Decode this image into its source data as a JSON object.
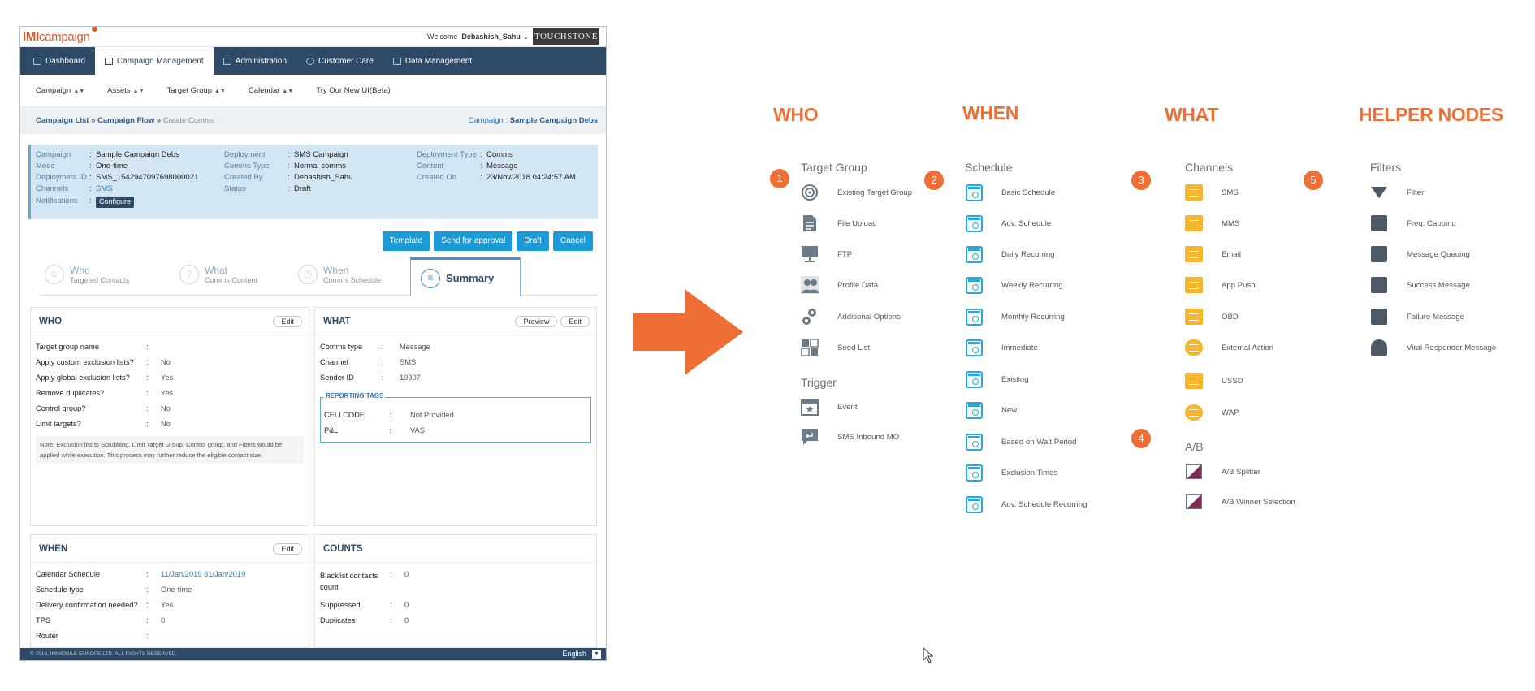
{
  "app": {
    "logo_imi": "IMI",
    "logo_rest": "campaign",
    "welcome_label": "Welcome",
    "username": "Debashish_Sahu",
    "brand": "TOUCHSTONE",
    "nav": [
      "Dashboard",
      "Campaign Management",
      "Administration",
      "Customer Care",
      "Data Management"
    ],
    "subnav": [
      "Campaign",
      "Assets",
      "Target Group",
      "Calendar",
      "Try Our New UI(Beta)"
    ],
    "breadcrumb": {
      "a": "Campaign List",
      "sep1": " » ",
      "b": "Campaign Flow",
      "sep2": " » ",
      "c": "Create Comms"
    },
    "campaign_link_label": "Campaign :",
    "campaign_link_value": "Sample Campaign Debs",
    "info": {
      "campaign_k": "Campaign",
      "campaign_v": "Sample Campaign Debs",
      "mode_k": "Mode",
      "mode_v": "One-time",
      "depid_k": "Deployment ID",
      "depid_v": "SMS_1542947097698000021",
      "channels_k": "Channels",
      "channels_v": "SMS",
      "notif_k": "Notifications",
      "notif_v": "Configure",
      "deployment_k": "Deployment",
      "deployment_v": "SMS Campaign",
      "commstype_k": "Comms Type",
      "commstype_v": "Normal comms",
      "createdby_k": "Created By",
      "createdby_v": "Debashish_Sahu",
      "status_k": "Status",
      "status_v": "Draft",
      "deptype_k": "Deployment Type",
      "deptype_v": "Comms",
      "content_k": "Content",
      "content_v": "Message",
      "createdon_k": "Created On",
      "createdon_v": "23/Nov/2018 04:24:57 AM"
    },
    "buttons": [
      "Template",
      "Send for approval",
      "Draft",
      "Cancel"
    ],
    "tabs": [
      {
        "title": "Who",
        "sub": "Targeted Contacts"
      },
      {
        "title": "What",
        "sub": "Comms Content"
      },
      {
        "title": "When",
        "sub": "Comms Schedule"
      },
      {
        "title": "Summary",
        "sub": ""
      }
    ],
    "who": {
      "title": "WHO",
      "edit": "Edit",
      "rows": [
        {
          "k": "Target group name",
          "v": ""
        },
        {
          "k": "Apply custom exclusion lists?",
          "v": "No"
        },
        {
          "k": "Apply global exclusion lists?",
          "v": "Yes"
        },
        {
          "k": "Remove duplicates?",
          "v": "Yes"
        },
        {
          "k": "Control group?",
          "v": "No"
        },
        {
          "k": "Limit targets?",
          "v": "No"
        }
      ],
      "note": "Note: Exclusion list(s) Scrubbing, Limit Target Group, Control group, and Filters would be applied while execution. This process may further reduce the eligible contact size."
    },
    "what": {
      "title": "WHAT",
      "preview": "Preview",
      "edit": "Edit",
      "rows": [
        {
          "k": "Comms type",
          "v": "Message"
        },
        {
          "k": "Channel",
          "v": "SMS"
        },
        {
          "k": "Sender ID",
          "v": "10907"
        }
      ],
      "tags_label": "REPORTING TAGS",
      "tags": [
        {
          "k": "CELLCODE",
          "v": "Not Provided"
        },
        {
          "k": "P&L",
          "v": "VAS"
        }
      ]
    },
    "when": {
      "title": "WHEN",
      "edit": "Edit",
      "rows": [
        {
          "k": "Calendar Schedule",
          "v": "11/Jan/2019 31/Jan/2019"
        },
        {
          "k": "Schedule type",
          "v": "One-time"
        },
        {
          "k": "Delivery confirmation needed?",
          "v": "Yes"
        },
        {
          "k": "TPS",
          "v": "0"
        },
        {
          "k": "Router",
          "v": ""
        }
      ]
    },
    "counts": {
      "title": "COUNTS",
      "rows": [
        {
          "k": "Blacklist contacts count",
          "v": "0"
        },
        {
          "k": "Suppressed",
          "v": "0"
        },
        {
          "k": "Duplicates",
          "v": "0"
        }
      ]
    },
    "footer": "© 2019, IMIMOBILE EUROPE LTD. ALL RIGHTS RESERVED.",
    "language": "English"
  },
  "legend": {
    "columns": {
      "who": "WHO",
      "when": "WHEN",
      "what": "WHAT",
      "helper": "HELPER NODES"
    },
    "numbers": [
      "1",
      "2",
      "3",
      "4",
      "5"
    ],
    "target_group": {
      "title": "Target Group",
      "items": [
        "Existing Target Group",
        "File Upload",
        "FTP",
        "Profile Data",
        "Additional Options",
        "Seed List"
      ]
    },
    "trigger": {
      "title": "Trigger",
      "items": [
        "Event",
        "SMS Inbound MO"
      ]
    },
    "schedule": {
      "title": "Schedule",
      "items": [
        "Basic Schedule",
        "Adv. Schedule",
        "Daily Recurring",
        "Weekly Recurring",
        "Monthly Recurring",
        "Immediate",
        "Existing",
        "New",
        "Based on Wait Period",
        "Exclusion Times",
        "Adv. Schedule Recurring"
      ]
    },
    "channels": {
      "title": "Channels",
      "items": [
        "SMS",
        "MMS",
        "Email",
        "App Push",
        "OBD",
        "External Action",
        "USSD",
        "WAP"
      ]
    },
    "ab": {
      "title": "A/B",
      "items": [
        "A/B Splitter",
        "A/B Winner Selection"
      ]
    },
    "filters": {
      "title": "Filters",
      "items": [
        "Filter",
        "Freq. Capping",
        "Message Queuing",
        "Success Message",
        "Failure Message",
        "Viral Responder Message"
      ]
    },
    "accent_color": "#ee6e36"
  }
}
